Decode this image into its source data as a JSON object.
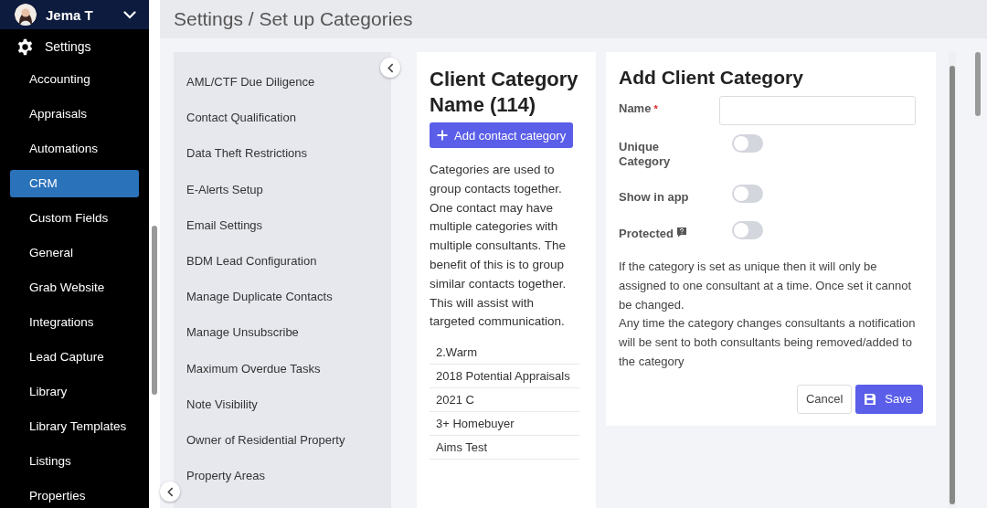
{
  "user": {
    "name": "Jema T"
  },
  "sidebar": {
    "section": "Settings",
    "items": [
      {
        "label": "Accounting",
        "selected": false
      },
      {
        "label": "Appraisals",
        "selected": false
      },
      {
        "label": "Automations",
        "selected": false
      },
      {
        "label": "CRM",
        "selected": true
      },
      {
        "label": "Custom Fields",
        "selected": false
      },
      {
        "label": "General",
        "selected": false
      },
      {
        "label": "Grab Website",
        "selected": false
      },
      {
        "label": "Integrations",
        "selected": false
      },
      {
        "label": "Lead Capture",
        "selected": false
      },
      {
        "label": "Library",
        "selected": false
      },
      {
        "label": "Library Templates",
        "selected": false
      },
      {
        "label": "Listings",
        "selected": false
      },
      {
        "label": "Properties",
        "selected": false
      }
    ]
  },
  "page_title": "Settings / Set up Categories",
  "settings_menu": {
    "items": [
      "AML/CTF Due Diligence",
      "Contact Qualification",
      "Data Theft Restrictions",
      "E-Alerts Setup",
      "Email Settings",
      "BDM Lead Configuration",
      "Manage Duplicate Contacts",
      "Manage Unsubscribe",
      "Maximum Overdue Tasks",
      "Note Visibility",
      "Owner of Residential Property",
      "Property Areas"
    ]
  },
  "category_list": {
    "title": "Client Category Name (114)",
    "add_button": "Add contact category",
    "description": "Categories are used to group contacts together. One contact may have multiple categories with multiple consultants. The benefit of this is to group similar contacts together. This will assist with targeted communication.",
    "items": [
      "2.Warm",
      "2018 Potential Appraisals",
      "2021 C",
      "3+ Homebuyer",
      "Aims Test"
    ]
  },
  "form": {
    "title": "Add Client Category",
    "fields": [
      {
        "kind": "text",
        "label": "Name",
        "required_mark": "*"
      },
      {
        "kind": "toggle",
        "label": "Unique Category",
        "on": false
      },
      {
        "kind": "toggle",
        "label": "Show in app",
        "on": false
      },
      {
        "kind": "toggle",
        "label": "Protected",
        "on": false,
        "help": true
      }
    ],
    "notes": [
      "If the category is set as unique then it will only be assigned to one consultant at a time. Once set it cannot be changed.",
      "Any time the category changes consultants a notification will be sent to both consultants being removed/added to the category"
    ],
    "buttons": {
      "cancel": "Cancel",
      "save": "Save"
    }
  }
}
